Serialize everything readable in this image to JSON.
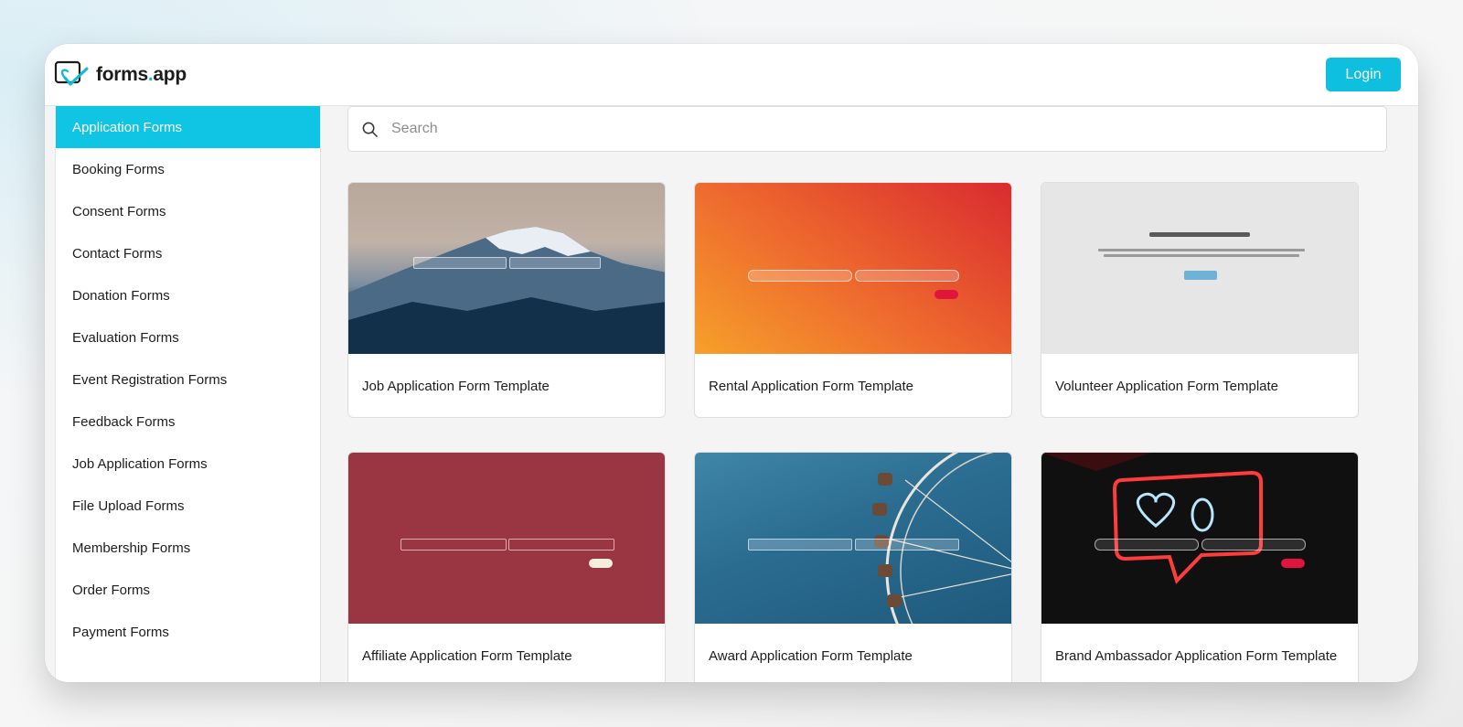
{
  "app": {
    "brand_name_main": "forms",
    "brand_name_dot": ".",
    "brand_name_tld": "app",
    "login_label": "Login"
  },
  "colors": {
    "accent": "#10c4e4",
    "login": "#0ebfe0",
    "text": "#1d1d1d"
  },
  "sidebar": {
    "items": [
      {
        "label": "Application Forms",
        "active": true
      },
      {
        "label": "Booking Forms"
      },
      {
        "label": "Consent Forms"
      },
      {
        "label": "Contact Forms"
      },
      {
        "label": "Donation Forms"
      },
      {
        "label": "Evaluation Forms"
      },
      {
        "label": "Event Registration Forms"
      },
      {
        "label": "Feedback Forms"
      },
      {
        "label": "Job Application Forms"
      },
      {
        "label": "File Upload Forms"
      },
      {
        "label": "Membership Forms"
      },
      {
        "label": "Order Forms"
      },
      {
        "label": "Payment Forms"
      }
    ]
  },
  "search": {
    "placeholder": "Search",
    "icon": "search-icon"
  },
  "templates": [
    {
      "title": "Job Application Form Template"
    },
    {
      "title": "Rental Application Form Template"
    },
    {
      "title": "Volunteer Application Form Template"
    },
    {
      "title": "Affiliate Application Form Template"
    },
    {
      "title": "Award Application Form Template"
    },
    {
      "title": "Brand Ambassador Application Form Template"
    }
  ]
}
